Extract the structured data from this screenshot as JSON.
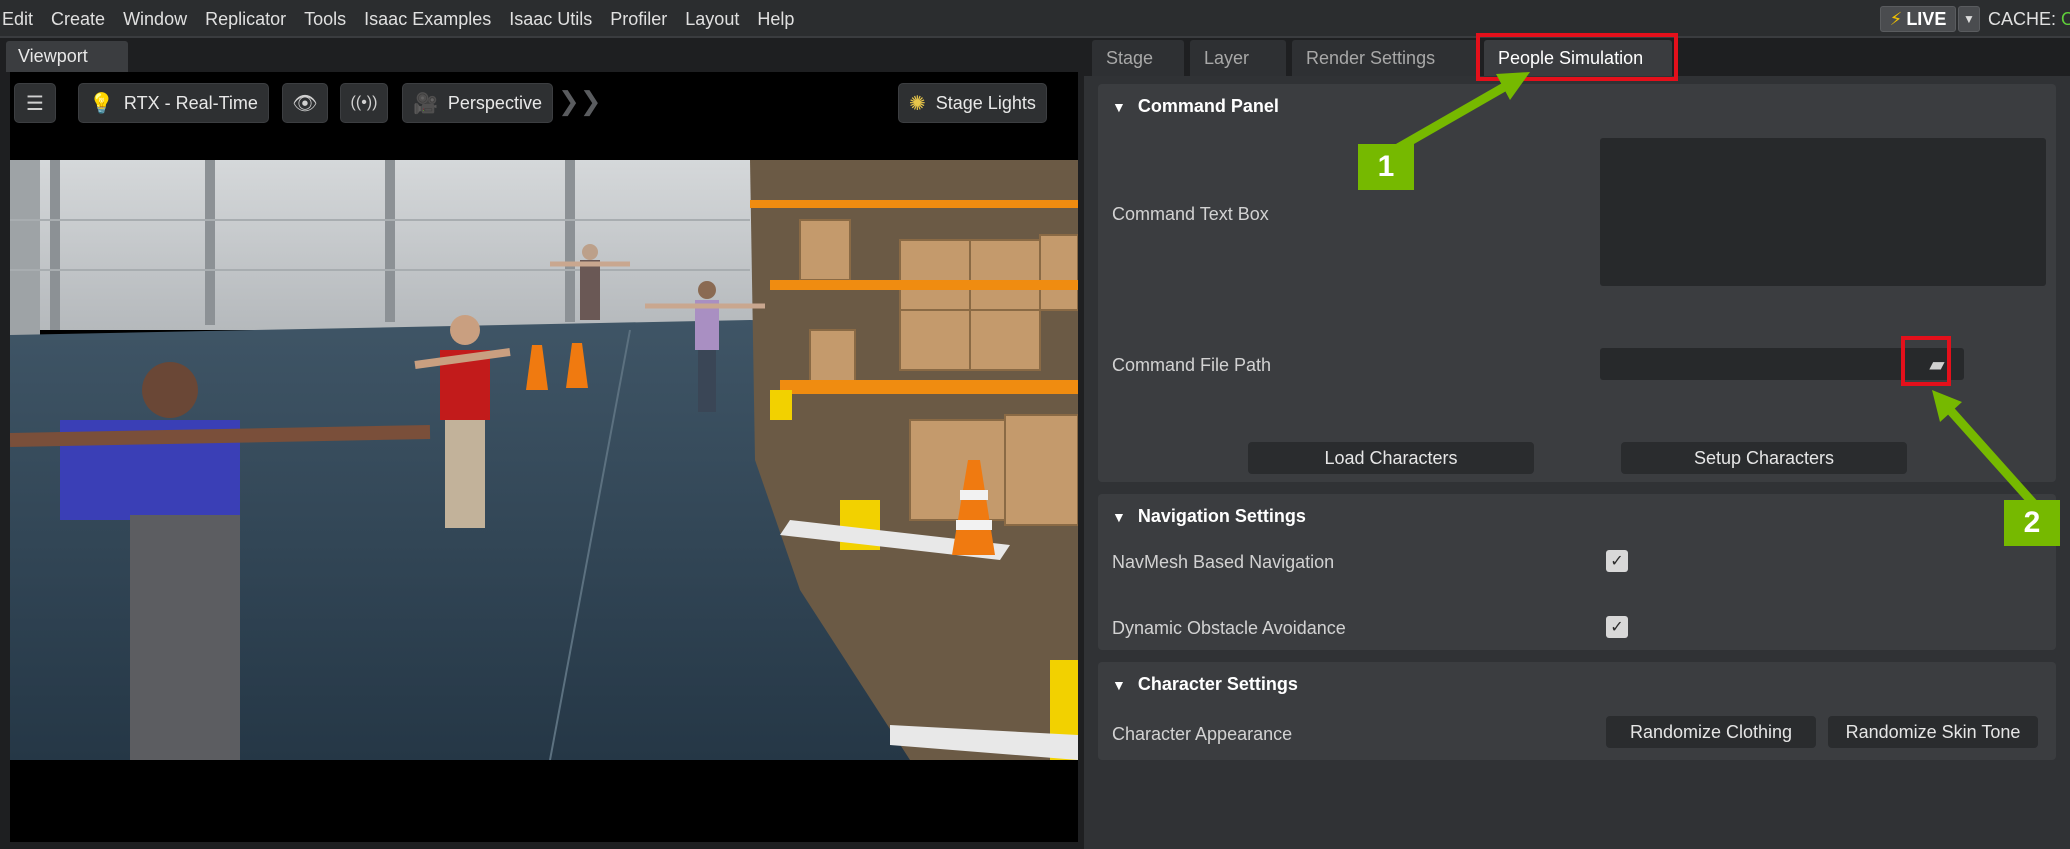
{
  "menubar": {
    "items": [
      "Edit",
      "Create",
      "Window",
      "Replicator",
      "Tools",
      "Isaac Examples",
      "Isaac Utils",
      "Profiler",
      "Layout",
      "Help"
    ],
    "live_label": "LIVE",
    "cache_label": "CACHE:",
    "cache_status": "O"
  },
  "viewport": {
    "tab_label": "Viewport",
    "render_mode": "RTX - Real-Time",
    "camera": "Perspective",
    "lights": "Stage Lights"
  },
  "right_panel": {
    "tabs": [
      "Stage",
      "Layer",
      "Render Settings",
      "People Simulation"
    ],
    "command_panel": {
      "title": "Command Panel",
      "text_box_label": "Command Text Box",
      "file_path_label": "Command File Path",
      "load_button": "Load Characters",
      "setup_button": "Setup Characters"
    },
    "navigation": {
      "title": "Navigation Settings",
      "navmesh_label": "NavMesh Based Navigation",
      "navmesh_checked": true,
      "avoidance_label": "Dynamic Obstacle Avoidance",
      "avoidance_checked": true
    },
    "character": {
      "title": "Character Settings",
      "appearance_label": "Character Appearance",
      "randomize_clothing": "Randomize Clothing",
      "randomize_skin": "Randomize Skin Tone"
    }
  },
  "annotations": {
    "badge_1": "1",
    "badge_2": "2",
    "color": "#76b900",
    "highlight_color": "#e4101b"
  }
}
